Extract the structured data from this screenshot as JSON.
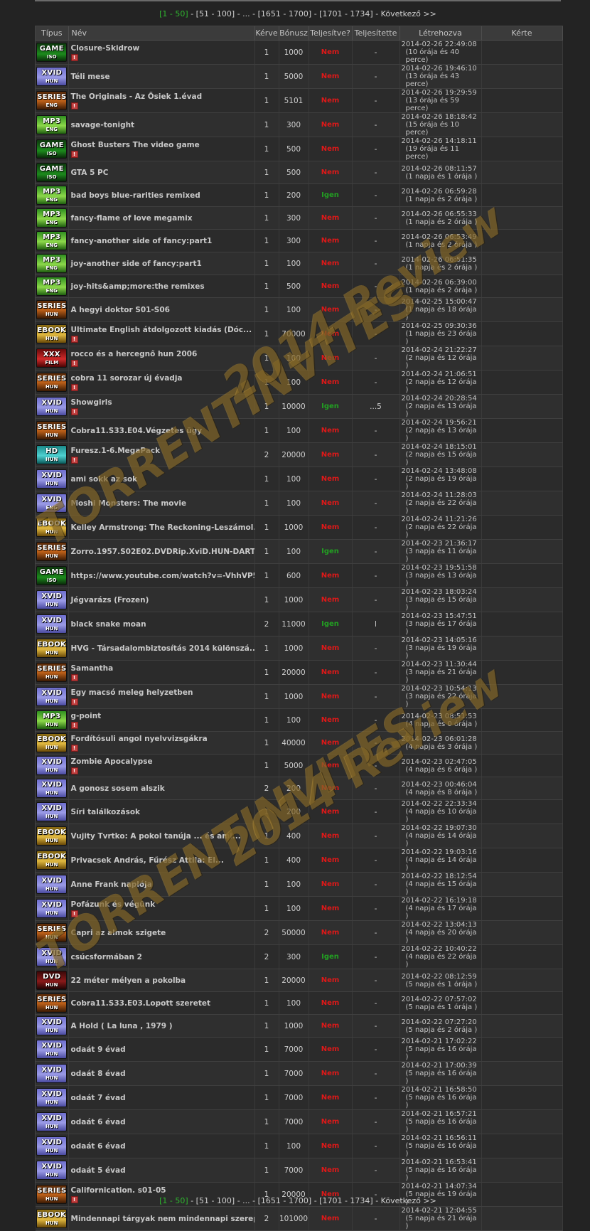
{
  "pager": {
    "current": "[1 - 50]",
    "p2": "[51 - 100]",
    "ellipsis": "...",
    "p3": "[1651 - 1700]",
    "p4": "[1701 - 1734]",
    "next": "Következő >>"
  },
  "headers": [
    "Típus",
    "Név",
    "Kérve",
    "Bónusz",
    "Teljesítve?",
    "Teljesítette",
    "Létrehozva",
    "Kérte"
  ],
  "watermark": {
    "line1": "TORRENTINVITES",
    "line2": "2014 Review"
  },
  "rows": [
    {
      "type": "game",
      "top": "GAME",
      "sub": "ISO",
      "name": "Closure-Skidrow",
      "warn": true,
      "req": "1",
      "bonus": "1000",
      "done": "Nem",
      "by": "-",
      "date": "2014-02-26 22:49:08",
      "ago": "(10 órája és 40 perce)"
    },
    {
      "type": "xvid",
      "top": "XVID",
      "sub": "HUN",
      "name": "Téli mese",
      "warn": false,
      "req": "1",
      "bonus": "5000",
      "done": "Nem",
      "by": "-",
      "date": "2014-02-26 19:46:10",
      "ago": "(13 órája és 43 perce)"
    },
    {
      "type": "series",
      "top": "SERIES",
      "sub": "ENG",
      "name": "The Originals - Az Ősiek 1.évad",
      "warn": true,
      "req": "1",
      "bonus": "5101",
      "done": "Nem",
      "by": "-",
      "date": "2014-02-26 19:29:59",
      "ago": "(13 órája és 59 perce)"
    },
    {
      "type": "mp3",
      "top": "MP3",
      "sub": "ENG",
      "name": "savage-tonight",
      "warn": false,
      "req": "1",
      "bonus": "300",
      "done": "Nem",
      "by": "-",
      "date": "2014-02-26 18:18:42",
      "ago": "(15 órája és 10 perce)"
    },
    {
      "type": "game",
      "top": "GAME",
      "sub": "ISO",
      "name": "Ghost Busters The video game",
      "warn": true,
      "req": "1",
      "bonus": "500",
      "done": "Nem",
      "by": "-",
      "date": "2014-02-26 14:18:11",
      "ago": "(19 órája és 11 perce)"
    },
    {
      "type": "game",
      "top": "GAME",
      "sub": "ISO",
      "name": "GTA 5 PC",
      "warn": false,
      "req": "1",
      "bonus": "500",
      "done": "Nem",
      "by": "-",
      "date": "2014-02-26 08:11:57",
      "ago": "(1 napja és 1 órája )"
    },
    {
      "type": "mp3",
      "top": "MP3",
      "sub": "ENG",
      "name": "bad boys blue-rarities remixed",
      "warn": false,
      "req": "1",
      "bonus": "200",
      "done": "Igen",
      "by": "-",
      "date": "2014-02-26 06:59:28",
      "ago": "(1 napja és 2 órája )"
    },
    {
      "type": "mp3",
      "top": "MP3",
      "sub": "ENG",
      "name": "fancy-flame of love megamix",
      "warn": false,
      "req": "1",
      "bonus": "300",
      "done": "Nem",
      "by": "-",
      "date": "2014-02-26 06:55:33",
      "ago": "(1 napja és 2 órája )"
    },
    {
      "type": "mp3",
      "top": "MP3",
      "sub": "ENG",
      "name": "fancy-another side of fancy:part1",
      "warn": false,
      "req": "1",
      "bonus": "300",
      "done": "Nem",
      "by": "-",
      "date": "2014-02-26 06:53:49",
      "ago": "(1 napja és 2 órája )"
    },
    {
      "type": "mp3",
      "top": "MP3",
      "sub": "ENG",
      "name": "joy-another side of fancy:part1",
      "warn": false,
      "req": "1",
      "bonus": "100",
      "done": "Nem",
      "by": "-",
      "date": "2014-02-26 06:51:35",
      "ago": "(1 napja és 2 órája )"
    },
    {
      "type": "mp3",
      "top": "MP3",
      "sub": "ENG",
      "name": "joy-hits&amp;more:the remixes",
      "warn": false,
      "req": "1",
      "bonus": "500",
      "done": "Nem",
      "by": "-",
      "date": "2014-02-26 06:39:00",
      "ago": "(1 napja és 2 órája )"
    },
    {
      "type": "series",
      "top": "SERIES",
      "sub": "HUN",
      "name": "A hegyi doktor S01-S06",
      "warn": false,
      "req": "1",
      "bonus": "100",
      "done": "Nem",
      "by": "-",
      "date": "2014-02-25 15:00:47",
      "ago": "(1 napja és 18 órája )"
    },
    {
      "type": "ebook",
      "top": "EBOOK",
      "sub": "HUN",
      "name": "Ultimate English átdolgozott kiadás (Dóc...",
      "warn": true,
      "req": "1",
      "bonus": "70000",
      "done": "Nem",
      "by": "-",
      "date": "2014-02-25 09:30:36",
      "ago": "(1 napja és 23 órája )"
    },
    {
      "type": "xxx",
      "top": "XXX",
      "sub": "FILM",
      "name": "rocco és a hercegnő hun 2006",
      "warn": true,
      "req": "1",
      "bonus": "100",
      "done": "Nem",
      "by": "-",
      "date": "2014-02-24 21:22:27",
      "ago": "(2 napja és 12 órája )"
    },
    {
      "type": "series",
      "top": "SERIES",
      "sub": "HUN",
      "name": "cobra 11 sorozar új évadja",
      "warn": true,
      "req": "1",
      "bonus": "100",
      "done": "Nem",
      "by": "-",
      "date": "2014-02-24 21:06:51",
      "ago": "(2 napja és 12 órája )"
    },
    {
      "type": "xvid",
      "top": "XVID",
      "sub": "HUN",
      "name": "Showgirls",
      "warn": true,
      "req": "1",
      "bonus": "10000",
      "done": "Igen",
      "by": "...5",
      "date": "2014-02-24 20:28:54",
      "ago": "(2 napja és 13 órája )"
    },
    {
      "type": "series",
      "top": "SERIES",
      "sub": "HUN",
      "name": "Cobra11.S33.E04.Végzetes ügy",
      "warn": false,
      "req": "1",
      "bonus": "100",
      "done": "Nem",
      "by": "-",
      "date": "2014-02-24 19:56:21",
      "ago": "(2 napja és 13 órája )"
    },
    {
      "type": "hd",
      "top": "HD",
      "sub": "HUN",
      "name": "Furesz.1-6.MegaPack",
      "warn": true,
      "req": "2",
      "bonus": "20000",
      "done": "Nem",
      "by": "-",
      "date": "2014-02-24 18:15:01",
      "ago": "(2 napja és 15 órája )"
    },
    {
      "type": "xvid",
      "top": "XVID",
      "sub": "HUN",
      "name": "ami sokk az sok",
      "warn": false,
      "req": "1",
      "bonus": "100",
      "done": "Nem",
      "by": "-",
      "date": "2014-02-24 13:48:08",
      "ago": "(2 napja és 19 órája )"
    },
    {
      "type": "xvid",
      "top": "XVID",
      "sub": "ENG",
      "name": "Moshi Monsters: The movie",
      "warn": false,
      "req": "1",
      "bonus": "100",
      "done": "Nem",
      "by": "-",
      "date": "2014-02-24 11:28:03",
      "ago": "(2 napja és 22 órája )"
    },
    {
      "type": "ebook",
      "top": "EBOOK",
      "sub": "HUN",
      "name": "Kelley Armstrong: The Reckoning-Leszámol...",
      "warn": false,
      "req": "1",
      "bonus": "1000",
      "done": "Nem",
      "by": "-",
      "date": "2014-02-24 11:21:26",
      "ago": "(2 napja és 22 órája )"
    },
    {
      "type": "series",
      "top": "SERIES",
      "sub": "HUN",
      "name": "Zorro.1957.S02E02.DVDRip.XviD.HUN-DART",
      "warn": false,
      "req": "1",
      "bonus": "100",
      "done": "Igen",
      "by": "-",
      "date": "2014-02-23 21:36:17",
      "ago": "(3 napja és 11 órája )"
    },
    {
      "type": "game",
      "top": "GAME",
      "sub": "ISO",
      "name": "https://www.youtube.com/watch?v=-VhhVP5q...",
      "warn": false,
      "req": "1",
      "bonus": "600",
      "done": "Nem",
      "by": "-",
      "date": "2014-02-23 19:51:58",
      "ago": "(3 napja és 13 órája )"
    },
    {
      "type": "xvid",
      "top": "XVID",
      "sub": "HUN",
      "name": "Jégvarázs (Frozen)",
      "warn": false,
      "req": "1",
      "bonus": "1000",
      "done": "Nem",
      "by": "-",
      "date": "2014-02-23 18:03:24",
      "ago": "(3 napja és 15 órája )"
    },
    {
      "type": "xvid",
      "top": "XVID",
      "sub": "HUN",
      "name": "black snake moan",
      "warn": false,
      "req": "2",
      "bonus": "11000",
      "done": "Igen",
      "by": "l",
      "date": "2014-02-23 15:47:51",
      "ago": "(3 napja és 17 órája )"
    },
    {
      "type": "ebook",
      "top": "EBOOK",
      "sub": "HUN",
      "name": "HVG - Társadalombiztosítás 2014 különszá...",
      "warn": false,
      "req": "1",
      "bonus": "1000",
      "done": "Nem",
      "by": "-",
      "date": "2014-02-23 14:05:16",
      "ago": "(3 napja és 19 órája )"
    },
    {
      "type": "series",
      "top": "SERIES",
      "sub": "HUN",
      "name": "Samantha",
      "warn": true,
      "req": "1",
      "bonus": "20000",
      "done": "Nem",
      "by": "-",
      "date": "2014-02-23 11:30:44",
      "ago": "(3 napja és 21 órája )"
    },
    {
      "type": "xvid",
      "top": "XVID",
      "sub": "HUN",
      "name": "Egy macsó meleg helyzetben",
      "warn": true,
      "req": "1",
      "bonus": "1000",
      "done": "Nem",
      "by": "-",
      "date": "2014-02-23 10:54:13",
      "ago": "(3 napja és 22 órája )"
    },
    {
      "type": "mp3",
      "top": "MP3",
      "sub": "HUN",
      "name": "g-point",
      "warn": true,
      "req": "1",
      "bonus": "100",
      "done": "Nem",
      "by": "-",
      "date": "2014-02-23 08:51:53",
      "ago": "(4 napja és 0 órája )"
    },
    {
      "type": "ebook",
      "top": "EBOOK",
      "sub": "HUN",
      "name": "Fordítósuli angol nyelvvizsgákra",
      "warn": true,
      "req": "1",
      "bonus": "40000",
      "done": "Nem",
      "by": "-",
      "date": "2014-02-23 06:01:28",
      "ago": "(4 napja és 3 órája )"
    },
    {
      "type": "xvid",
      "top": "XVID",
      "sub": "HUN",
      "name": "Zombie Apocalypse",
      "warn": true,
      "req": "1",
      "bonus": "5000",
      "done": "Nem",
      "by": "-",
      "date": "2014-02-23 02:47:05",
      "ago": "(4 napja és 6 órája )"
    },
    {
      "type": "xvid",
      "top": "XVID",
      "sub": "HUN",
      "name": "A gonosz sosem alszik",
      "warn": false,
      "req": "2",
      "bonus": "200",
      "done": "Nem",
      "by": "-",
      "date": "2014-02-23 00:46:04",
      "ago": "(4 napja és 8 órája )"
    },
    {
      "type": "xvid",
      "top": "XVID",
      "sub": "HUN",
      "name": "Síri találkozások",
      "warn": false,
      "req": "1",
      "bonus": "200",
      "done": "Nem",
      "by": "-",
      "date": "2014-02-22 22:33:34",
      "ago": "(4 napja és 10 órája )"
    },
    {
      "type": "ebook",
      "top": "EBOOK",
      "sub": "HUN",
      "name": "Vujity Tvrtko: A pokol tanúja ... és ami...",
      "warn": false,
      "req": "1",
      "bonus": "400",
      "done": "Nem",
      "by": "-",
      "date": "2014-02-22 19:07:30",
      "ago": "(4 napja és 14 órája )"
    },
    {
      "type": "ebook",
      "top": "EBOOK",
      "sub": "HUN",
      "name": "Privacsek András, Fűrész Attila: El...",
      "warn": false,
      "req": "1",
      "bonus": "400",
      "done": "Nem",
      "by": "-",
      "date": "2014-02-22 19:03:16",
      "ago": "(4 napja és 14 órája )"
    },
    {
      "type": "xvid",
      "top": "XVID",
      "sub": "HUN",
      "name": "Anne Frank naplója",
      "warn": false,
      "req": "1",
      "bonus": "100",
      "done": "Nem",
      "by": "-",
      "date": "2014-02-22 18:12:54",
      "ago": "(4 napja és 15 órája )"
    },
    {
      "type": "xvid",
      "top": "XVID",
      "sub": "HUN",
      "name": "Pofázunk és végünk",
      "warn": true,
      "req": "1",
      "bonus": "100",
      "done": "Nem",
      "by": "-",
      "date": "2014-02-22 16:19:18",
      "ago": "(4 napja és 17 órája )"
    },
    {
      "type": "series",
      "top": "SERIES",
      "sub": "HUN",
      "name": "Capri az almok szigete",
      "warn": false,
      "req": "2",
      "bonus": "50000",
      "done": "Nem",
      "by": "-",
      "date": "2014-02-22 13:04:13",
      "ago": "(4 napja és 20 órája )"
    },
    {
      "type": "xvid",
      "top": "XVID",
      "sub": "HUN",
      "name": "csúcsformában 2",
      "warn": false,
      "req": "2",
      "bonus": "300",
      "done": "Igen",
      "by": "-",
      "date": "2014-02-22 10:40:22",
      "ago": "(4 napja és 22 órája )"
    },
    {
      "type": "dvd",
      "top": "DVD",
      "sub": "HUN",
      "name": "22 méter mélyen a pokolba",
      "warn": false,
      "req": "1",
      "bonus": "20000",
      "done": "Nem",
      "by": "-",
      "date": "2014-02-22 08:12:59",
      "ago": "(5 napja és 1 órája )"
    },
    {
      "type": "series",
      "top": "SERIES",
      "sub": "HUN",
      "name": "Cobra11.S33.E03.Lopott szeretet",
      "warn": false,
      "req": "1",
      "bonus": "100",
      "done": "Nem",
      "by": "-",
      "date": "2014-02-22 07:57:02",
      "ago": "(5 napja és 1 órája )"
    },
    {
      "type": "xvid",
      "top": "XVID",
      "sub": "HUN",
      "name": "A Hold ( La luna , 1979 )",
      "warn": false,
      "req": "1",
      "bonus": "1000",
      "done": "Nem",
      "by": "-",
      "date": "2014-02-22 07:27:20",
      "ago": "(5 napja és 2 órája )"
    },
    {
      "type": "xvid",
      "top": "XVID",
      "sub": "HUN",
      "name": "odaát 9 évad",
      "warn": false,
      "req": "1",
      "bonus": "7000",
      "done": "Nem",
      "by": "-",
      "date": "2014-02-21 17:02:22",
      "ago": "(5 napja és 16 órája )"
    },
    {
      "type": "xvid",
      "top": "XVID",
      "sub": "HUN",
      "name": "odaát 8 évad",
      "warn": false,
      "req": "1",
      "bonus": "7000",
      "done": "Nem",
      "by": "-",
      "date": "2014-02-21 17:00:39",
      "ago": "(5 napja és 16 órája )"
    },
    {
      "type": "xvid",
      "top": "XVID",
      "sub": "HUN",
      "name": "odaát 7 évad",
      "warn": false,
      "req": "1",
      "bonus": "7000",
      "done": "Nem",
      "by": "-",
      "date": "2014-02-21 16:58:50",
      "ago": "(5 napja és 16 órája )"
    },
    {
      "type": "xvid",
      "top": "XVID",
      "sub": "HUN",
      "name": "odaát 6 évad",
      "warn": false,
      "req": "1",
      "bonus": "7000",
      "done": "Nem",
      "by": "-",
      "date": "2014-02-21 16:57:21",
      "ago": "(5 napja és 16 órája )"
    },
    {
      "type": "xvid",
      "top": "XVID",
      "sub": "HUN",
      "name": "odaát 6 évad",
      "warn": false,
      "req": "1",
      "bonus": "100",
      "done": "Nem",
      "by": "-",
      "date": "2014-02-21 16:56:11",
      "ago": "(5 napja és 16 órája )"
    },
    {
      "type": "xvid",
      "top": "XVID",
      "sub": "HUN",
      "name": "odaát 5 évad",
      "warn": false,
      "req": "1",
      "bonus": "7000",
      "done": "Nem",
      "by": "-",
      "date": "2014-02-21 16:53:41",
      "ago": "(5 napja és 16 órája )"
    },
    {
      "type": "series",
      "top": "SERIES",
      "sub": "HUN",
      "name": "Californication. s01-05",
      "warn": true,
      "req": "1",
      "bonus": "20000",
      "done": "Nem",
      "by": "-",
      "date": "2014-02-21 14:07:34",
      "ago": "(5 napja és 19 órája )"
    },
    {
      "type": "ebook",
      "top": "EBOOK",
      "sub": "HUN",
      "name": "Mindennapi tárgyak nem mindennapi szerep...",
      "warn": false,
      "req": "2",
      "bonus": "101000",
      "done": "Nem",
      "by": "-",
      "date": "2014-02-21 12:04:55",
      "ago": "(5 napja és 21 órája )"
    }
  ]
}
